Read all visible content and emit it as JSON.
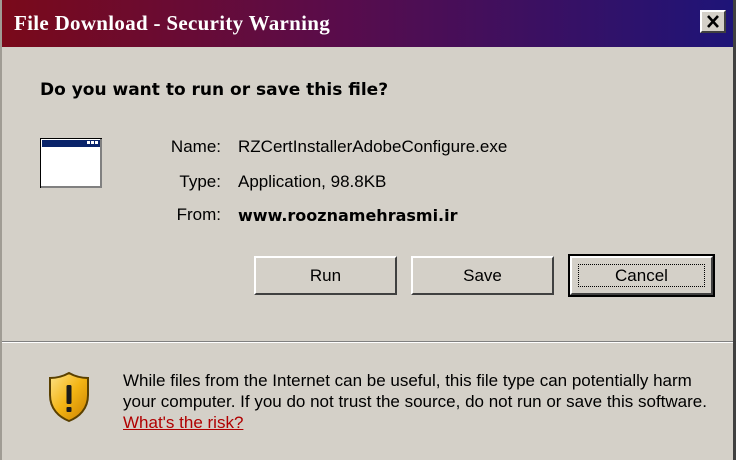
{
  "window": {
    "title": "File Download - Security Warning",
    "close_label": "×"
  },
  "prompt": {
    "question": "Do you want to run or save this file?"
  },
  "file": {
    "name_label": "Name:",
    "name_value": "RZCertInstallerAdobeConfigure.exe",
    "type_label": "Type:",
    "type_value": "Application, 98.8KB",
    "from_label": "From:",
    "from_value": "www.rooznamehrasmi.ir",
    "icon": "application-window-icon"
  },
  "buttons": {
    "run": "Run",
    "save": "Save",
    "cancel": "Cancel"
  },
  "warning": {
    "icon": "security-shield-icon",
    "message": "While files from the Internet can be useful, this file type can potentially harm your computer. If you do not trust the source, do not run or save this software.",
    "link_text": "What's the risk?"
  },
  "colors": {
    "dialog_face": "#d4d0c8",
    "title_gradient_start": "#7a0a1a",
    "title_gradient_end": "#1e1478",
    "link": "#b00000",
    "shield": "#f0b000"
  }
}
